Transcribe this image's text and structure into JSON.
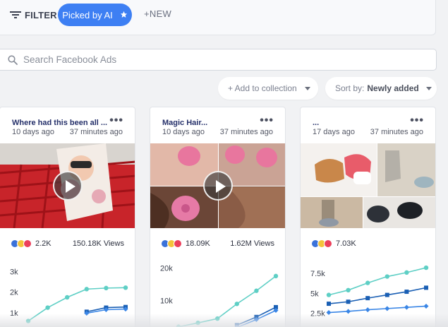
{
  "toolbar": {
    "filter_label": "FILTER",
    "picked_label": "Picked by AI",
    "new_label": "+NEW"
  },
  "search": {
    "placeholder": "Search Facebook Ads"
  },
  "controls": {
    "add_collection": "+ Add to collection",
    "sort_prefix": "Sort by:",
    "sort_value": "Newly added"
  },
  "colors": {
    "accent": "#3d7ff3",
    "teal": "#5ecfc5",
    "blue_dark": "#1a5fb4",
    "blue_mid": "#3a86e6"
  },
  "cards": [
    {
      "title": "Where had this been all ...",
      "posted": "10 days ago",
      "updated": "37 minutes ago",
      "reactions": "2.2K",
      "views": "150.18K Views",
      "has_video": true
    },
    {
      "title": "Magic Hair...",
      "posted": "10 days ago",
      "updated": "37 minutes ago",
      "reactions": "18.09K",
      "views": "1.62M Views",
      "has_video": true
    },
    {
      "title": "...",
      "posted": "17 days ago",
      "updated": "37 minutes ago",
      "reactions": "7.03K",
      "views": "",
      "has_video": false
    }
  ],
  "chart_data": [
    {
      "type": "line",
      "ylim": [
        0,
        3500
      ],
      "yticks": [
        1000,
        2000,
        3000
      ],
      "ytick_labels": [
        "1k",
        "2k",
        "3k"
      ],
      "series": [
        {
          "color": "#5ecfc5",
          "marker": "circle",
          "values": [
            600,
            1250,
            1750,
            2150,
            2200,
            2220
          ]
        },
        {
          "color": "#1a5fb4",
          "marker": "square",
          "values": [
            null,
            null,
            null,
            1050,
            1250,
            1280
          ]
        },
        {
          "color": "#3a86e6",
          "marker": "diamond",
          "values": [
            null,
            null,
            null,
            980,
            1150,
            1180
          ]
        }
      ]
    },
    {
      "type": "line",
      "ylim": [
        0,
        22000
      ],
      "yticks": [
        10000,
        20000
      ],
      "ytick_labels": [
        "10k",
        "20k"
      ],
      "series": [
        {
          "color": "#5ecfc5",
          "marker": "circle",
          "values": [
            2000,
            3200,
            4500,
            9000,
            13000,
            17500
          ]
        },
        {
          "color": "#1a5fb4",
          "marker": "square",
          "values": [
            null,
            null,
            null,
            2500,
            5000,
            8000
          ]
        },
        {
          "color": "#3a86e6",
          "marker": "diamond",
          "values": [
            null,
            null,
            null,
            1800,
            4200,
            7000
          ]
        }
      ]
    },
    {
      "type": "line",
      "ylim": [
        0,
        9000
      ],
      "yticks": [
        2500,
        5000,
        7500
      ],
      "ytick_labels": [
        "2.5k",
        "5k",
        "7.5k"
      ],
      "series": [
        {
          "color": "#5ecfc5",
          "marker": "circle",
          "values": [
            4800,
            5400,
            6300,
            7100,
            7600,
            8200
          ]
        },
        {
          "color": "#1a5fb4",
          "marker": "square",
          "values": [
            3700,
            3950,
            4400,
            4800,
            5200,
            5700
          ]
        },
        {
          "color": "#3a86e6",
          "marker": "diamond",
          "values": [
            2600,
            2750,
            2950,
            3100,
            3250,
            3400
          ]
        }
      ]
    }
  ]
}
